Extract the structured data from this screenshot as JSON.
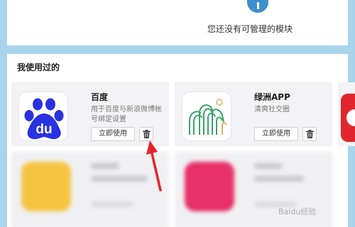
{
  "top_panel": {
    "empty_message": "您还没有可管理的模块"
  },
  "section": {
    "title": "我使用过的"
  },
  "apps": [
    {
      "name": "百度",
      "description": "用于百度与新浪微博帐号绑定设置",
      "use_label": "立即使用",
      "icon": "baidu-paw-icon"
    },
    {
      "name": "绿洲APP",
      "description": "清爽社交圈",
      "use_label": "立即使用",
      "icon": "oasis-icon"
    }
  ],
  "watermark": "Baidu经验",
  "colors": {
    "background": "#a8d4ec",
    "baidu_blue": "#2932e1",
    "oasis_green": "#3aa36a",
    "annotation_red": "#e8232a"
  }
}
